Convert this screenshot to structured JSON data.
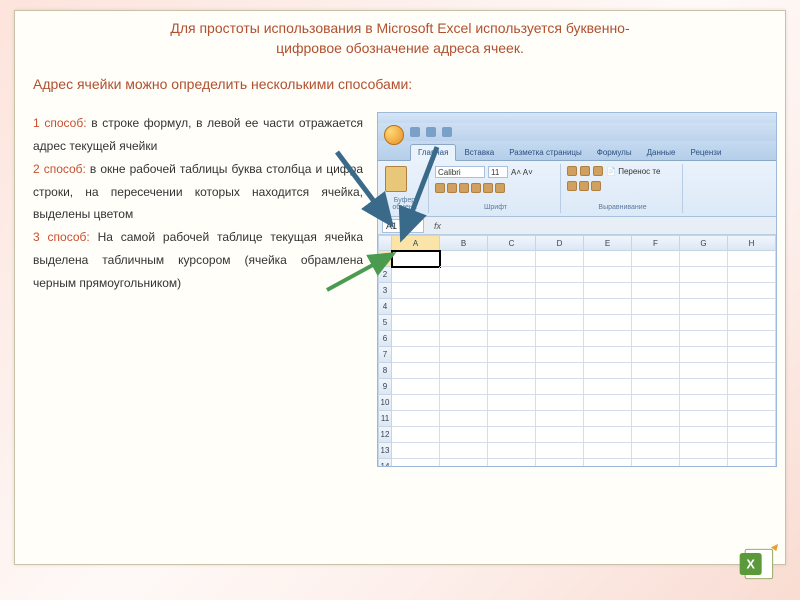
{
  "title_line1": "Для простоты использования в Microsoft Excel используется буквенно-",
  "title_line2": "цифровое обозначение адреса ячеек.",
  "subtitle": "Адрес ячейки можно определить несколькими способами:",
  "methods": [
    {
      "label": "1 способ:",
      "text": " в строке формул, в левой ее части отражается адрес текущей ячейки"
    },
    {
      "label": "2 способ:",
      "text": " в окне рабочей таблицы буква столбца и цифра строки, на пересечении которых находится ячейка, выделены цветом"
    },
    {
      "label": "3 способ:",
      "text": " На самой рабочей таблице текущая ячейка выделена табличным курсором (ячейка обрамлена черным прямоугольником)"
    }
  ],
  "excel": {
    "tabs": [
      "Главная",
      "Вставка",
      "Разметка страницы",
      "Формулы",
      "Данные",
      "Рецензи"
    ],
    "activeTab": "Главная",
    "ribbon_groups": [
      "Буфер обмена",
      "Шрифт",
      "Выравнивание"
    ],
    "font_name": "Calibri",
    "font_size": "11",
    "wrap_label": "Перенос те",
    "name_box": "A1",
    "fx": "fx",
    "columns": [
      "A",
      "B",
      "C",
      "D",
      "E",
      "F",
      "G",
      "H"
    ],
    "active_col": "A",
    "num_rows": 14,
    "active_row": 1
  }
}
